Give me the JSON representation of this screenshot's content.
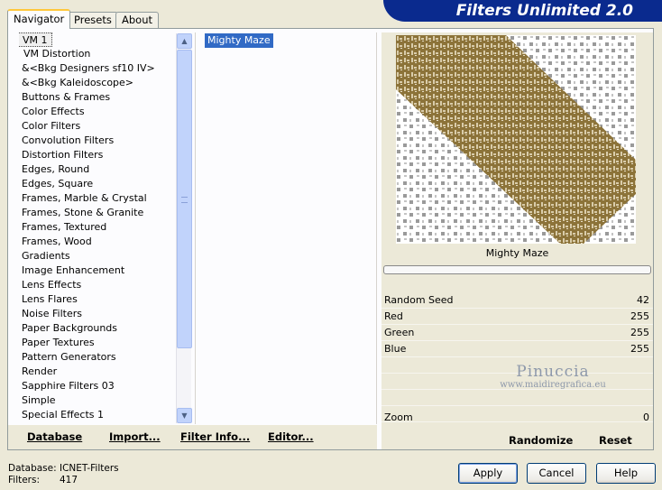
{
  "window": {
    "title": "Filters Unlimited 2.0"
  },
  "tabs": [
    {
      "label": "Navigator",
      "active": true
    },
    {
      "label": "Presets",
      "active": false
    },
    {
      "label": "About",
      "active": false
    }
  ],
  "categories": {
    "selected": "VM 1",
    "items": [
      "VM 1",
      "VM Distortion",
      "&<Bkg Designers sf10 IV>",
      "&<Bkg Kaleidoscope>",
      "Buttons & Frames",
      "Color Effects",
      "Color Filters",
      "Convolution Filters",
      "Distortion Filters",
      "Edges, Round",
      "Edges, Square",
      "Frames, Marble & Crystal",
      "Frames, Stone & Granite",
      "Frames, Textured",
      "Frames, Wood",
      "Gradients",
      "Image Enhancement",
      "Lens Effects",
      "Lens Flares",
      "Noise Filters",
      "Paper Backgrounds",
      "Paper Textures",
      "Pattern Generators",
      "Render",
      "Sapphire Filters 03",
      "Simple",
      "Special Effects 1"
    ]
  },
  "filters": {
    "selected": "Mighty Maze"
  },
  "preview": {
    "filter_name": "Mighty Maze",
    "maze_color": "#8c7339",
    "pattern_color": "#9a9a9a"
  },
  "parameters": [
    {
      "label": "Random Seed",
      "value": "42"
    },
    {
      "label": "Red",
      "value": "255"
    },
    {
      "label": "Green",
      "value": "255"
    },
    {
      "label": "Blue",
      "value": "255"
    }
  ],
  "zoom": {
    "label": "Zoom",
    "value": "0"
  },
  "watermark": {
    "name": "Pinuccia",
    "url": "www.maidiregrafica.eu"
  },
  "left_buttons": {
    "database": "Database",
    "import": "Import...",
    "filter_info": "Filter Info...",
    "editor": "Editor..."
  },
  "right_buttons": {
    "randomize": "Randomize",
    "reset": "Reset"
  },
  "status": {
    "database_label": "Database:",
    "database_value": "ICNET-Filters",
    "filters_label": "Filters:",
    "filters_value": "417"
  },
  "dialog_buttons": {
    "apply": "Apply",
    "cancel": "Cancel",
    "help": "Help"
  },
  "colors": {
    "accent": "#316ac5",
    "title_banner": "#0a2a8e",
    "tab_highlight": "#ffc83c"
  }
}
